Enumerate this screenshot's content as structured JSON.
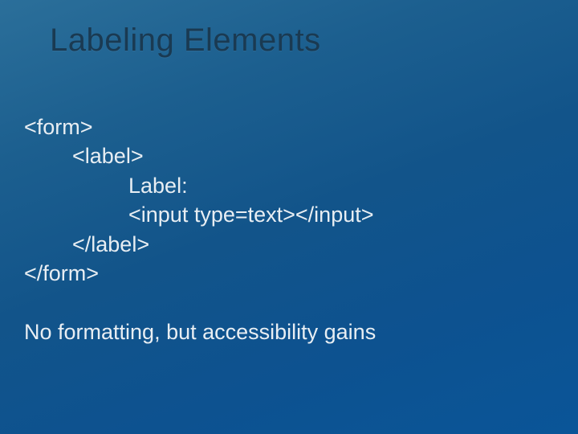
{
  "title": "Labeling Elements",
  "code": {
    "l1": "<form>",
    "l2": "<label>",
    "l3": "Label:",
    "l4": "<input type=text></input>",
    "l5": "</label>",
    "l6": "</form>"
  },
  "footnote": "No formatting, but accessibility gains"
}
